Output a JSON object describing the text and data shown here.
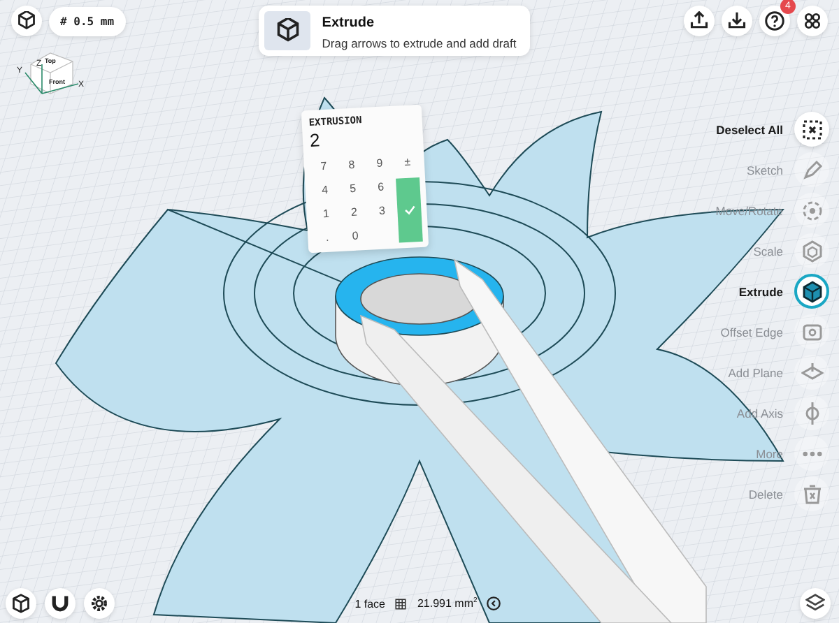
{
  "top_bar": {
    "grid_size": "# 0.5 mm",
    "badge": "4"
  },
  "tooltip": {
    "title": "Extrude",
    "text": "Drag arrows to extrude and add draft"
  },
  "view_cube": {
    "top": "Top",
    "front": "Front",
    "axes": [
      "X",
      "Y",
      "Z"
    ]
  },
  "keypad": {
    "label": "EXTRUSION",
    "value": "2",
    "keys": [
      "7",
      "8",
      "9",
      "±",
      "4",
      "5",
      "6",
      "1",
      "2",
      "3",
      ".",
      "0"
    ]
  },
  "tools": [
    {
      "label": "Deselect All",
      "kind": "action",
      "selected": false
    },
    {
      "label": "Sketch",
      "kind": "tool",
      "selected": false
    },
    {
      "label": "Move/Rotate",
      "kind": "tool",
      "selected": false
    },
    {
      "label": "Scale",
      "kind": "tool",
      "selected": false
    },
    {
      "label": "Extrude",
      "kind": "tool",
      "selected": true
    },
    {
      "label": "Offset Edge",
      "kind": "tool",
      "selected": false
    },
    {
      "label": "Add Plane",
      "kind": "tool",
      "selected": false
    },
    {
      "label": "Add Axis",
      "kind": "tool",
      "selected": false
    },
    {
      "label": "More",
      "kind": "tool",
      "selected": false
    },
    {
      "label": "Delete",
      "kind": "tool",
      "selected": false
    }
  ],
  "status": {
    "selection": "1 face",
    "area": "21.991 mm$^{2}$"
  }
}
